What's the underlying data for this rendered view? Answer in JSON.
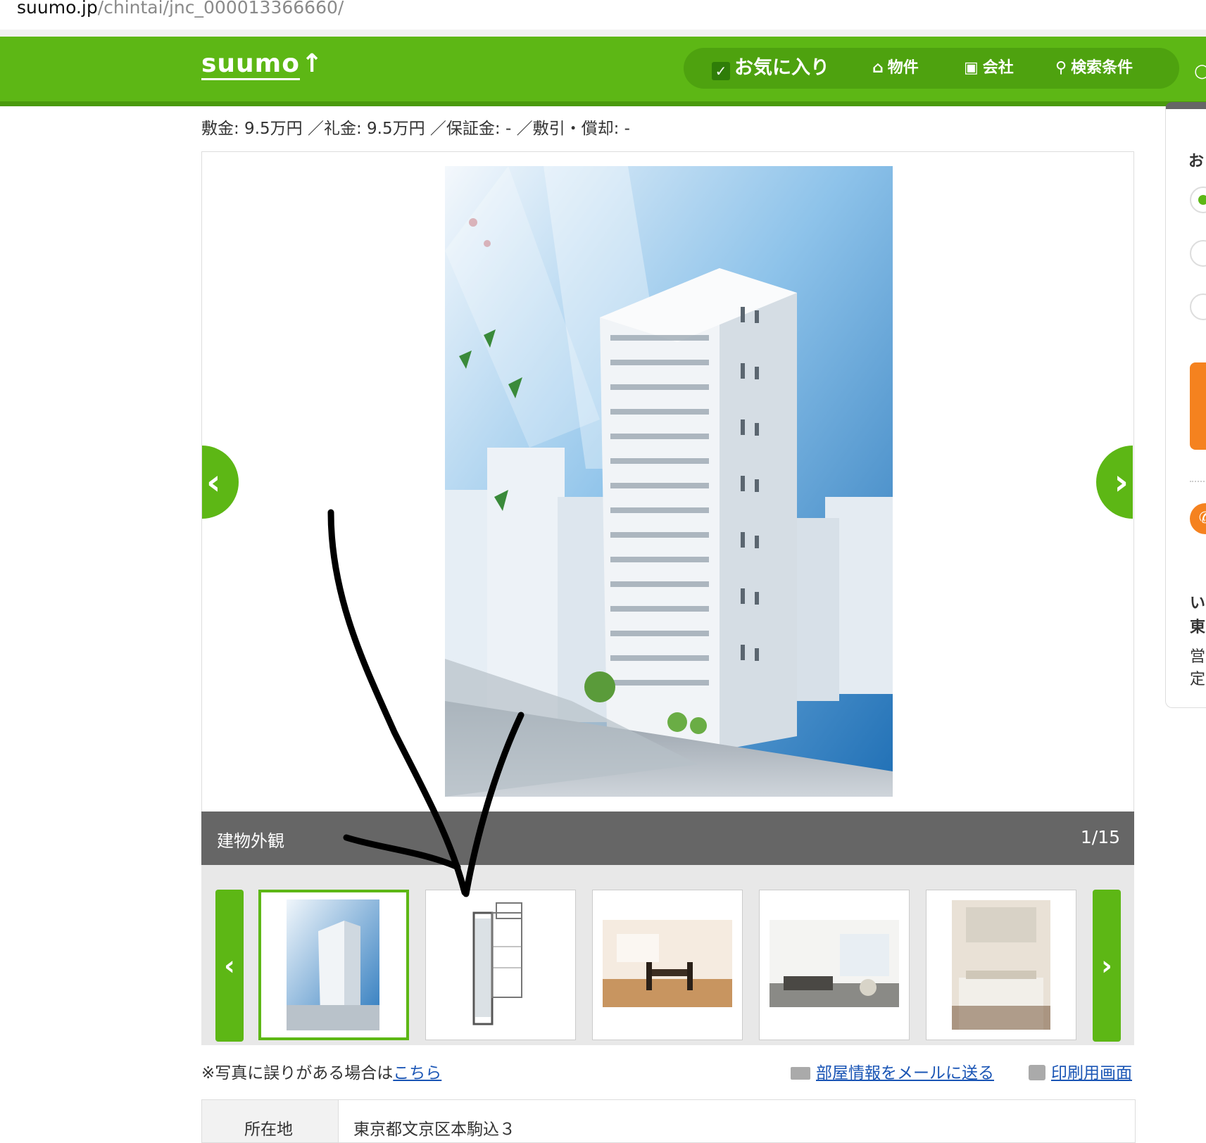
{
  "urlbar": {
    "host": "suumo.jp",
    "path": "/chintai/jnc_000013366660/"
  },
  "header": {
    "logo": "suumo",
    "nav": {
      "favorites": "お気に入り",
      "properties": "物件",
      "company": "会社",
      "search_conditions": "検索条件"
    }
  },
  "deposit_line": "敷金: 9.5万円 ／礼金: 9.5万円 ／保証金: - ／敷引・償却: -",
  "gallery": {
    "caption": "建物外観",
    "counter": "1/15"
  },
  "note": {
    "text": "※写真に誤りがある場合は",
    "link": "こちら"
  },
  "actions": {
    "mail": "部屋情報をメールに送る",
    "print": "印刷用画面"
  },
  "table": {
    "label": "所在地",
    "value": "東京都文京区本駒込３"
  },
  "side_panel": {
    "title": "お",
    "red_mark": "【",
    "lines": [
      "い",
      "東",
      "営",
      "定"
    ]
  },
  "colors": {
    "brand_green": "#5db715",
    "accent_orange": "#f5821f",
    "link_blue": "#1a55b5"
  }
}
